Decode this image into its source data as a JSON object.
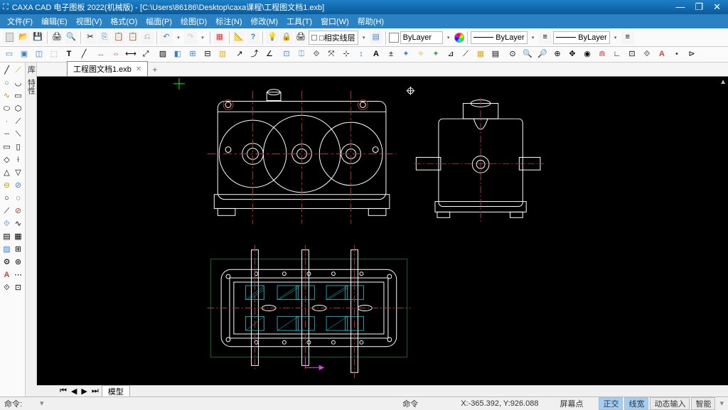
{
  "app": {
    "name": "CAXA CAD 电子图板",
    "version": "2022(机械版)",
    "filepath": "[C:\\Users\\86186\\Desktop\\caxa课程\\工程图文档1.exb]"
  },
  "menu": {
    "items": [
      "文件(F)",
      "编辑(E)",
      "视图(V)",
      "格式(O)",
      "幅面(P)",
      "绘图(D)",
      "标注(N)",
      "修改(M)",
      "工具(T)",
      "窗口(W)",
      "帮助(H)"
    ]
  },
  "toolbar1": {
    "viewtype": "□相实线层",
    "bylayer1": "ByLayer",
    "bylayer2": "ByLayer",
    "bylayer3": "ByLayer"
  },
  "document": {
    "tabname": "工程图文档1.exb",
    "modeltab": "模型"
  },
  "sidetabs": {
    "a": "库",
    "b": "特性"
  },
  "status": {
    "cmdlabel": "命令:",
    "cmdhint": "命令",
    "coords": "X:-365.392, Y:926.088",
    "snap": "屏幕点",
    "ortho": "正交",
    "osnap": "线宽",
    "dyn": "动态输入",
    "smart": "智能"
  },
  "winbtns": {
    "min": "—",
    "max": "❐",
    "close": "✕"
  }
}
